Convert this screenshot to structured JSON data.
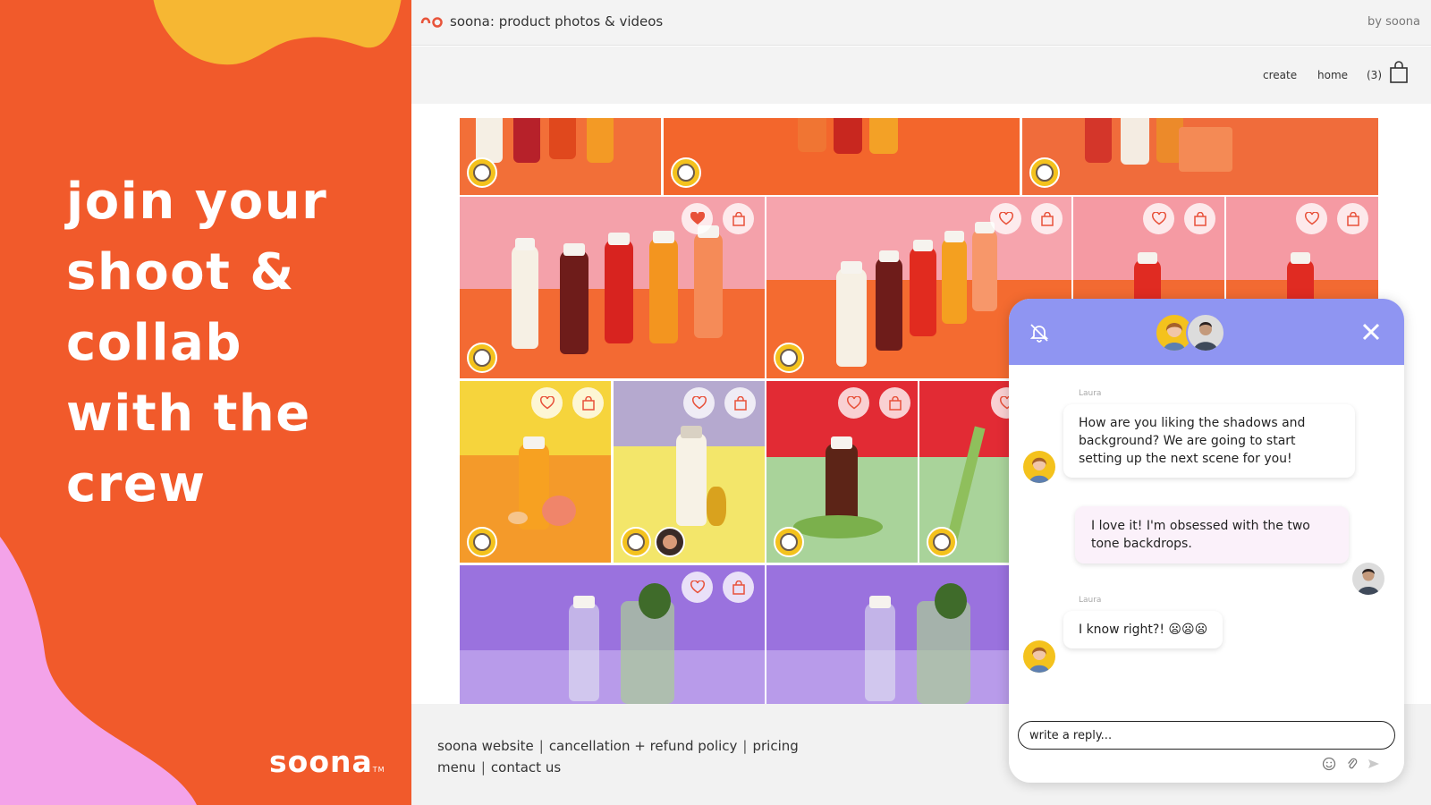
{
  "left_panel": {
    "headline": [
      "join your",
      "shoot &",
      "collab",
      "with the",
      "crew"
    ],
    "logo": "soona",
    "logo_tm": "TM",
    "colors": {
      "background": "#f15a2b",
      "yellow_blob": "#f6b733",
      "pink_blob": "#f3a3e9"
    }
  },
  "browser": {
    "title": "soona: product photos & videos",
    "by": "by soona",
    "nav": {
      "create": "create",
      "home": "home",
      "cart_count": "(3)",
      "bag_icon": "shopping-bag-icon"
    }
  },
  "gallery": {
    "tile_buttons": [
      "heart-icon",
      "shopping-bag-icon"
    ],
    "favorited_first_tile": true
  },
  "footer": {
    "links": [
      "soona website",
      "cancellation + refund policy",
      "pricing",
      "menu",
      "contact us"
    ],
    "separator": "|"
  },
  "chat": {
    "header_color": "#8f95f2",
    "messages": [
      {
        "sender": "Laura",
        "text": "How are you liking the shadows and background? We are going to start setting up the next scene for you!"
      },
      {
        "sender": "",
        "text": "I love it! I'm obsessed with the two tone backdrops."
      },
      {
        "sender": "Laura",
        "text": "I know right?! 😦😦😦"
      }
    ],
    "reply_placeholder": "write a reply...",
    "icons": [
      "mute-bell-icon",
      "close-icon",
      "emoji-icon",
      "attach-icon",
      "send-icon"
    ]
  }
}
